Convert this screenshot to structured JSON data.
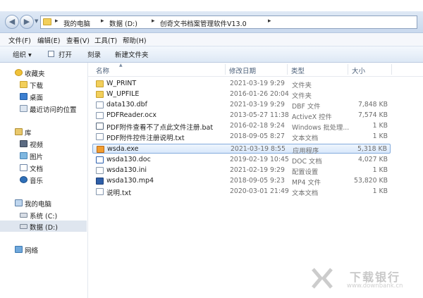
{
  "address": {
    "breadcrumbs": [
      "我的电脑",
      "数据 (D:)",
      "创奇文书档案管理软件V13.0"
    ]
  },
  "menu": [
    "文件(F)",
    "编辑(E)",
    "查看(V)",
    "工具(T)",
    "帮助(H)"
  ],
  "toolbar": {
    "organize": "组织",
    "open": "打开",
    "burn": "刻录",
    "new_folder": "新建文件夹"
  },
  "nav": {
    "favorites": "收藏夹",
    "downloads": "下载",
    "desktop": "桌面",
    "recent": "最近访问的位置",
    "libraries": "库",
    "videos": "视频",
    "pictures": "图片",
    "documents": "文档",
    "music": "音乐",
    "computer": "我的电脑",
    "drive_c": "系统 (C:)",
    "drive_d": "数据 (D:)",
    "network": "网络"
  },
  "columns": {
    "name": "名称",
    "date": "修改日期",
    "type": "类型",
    "size": "大小"
  },
  "files": [
    {
      "name": "W_PRINT",
      "date": "2021-03-19 9:29",
      "type": "文件夹",
      "size": "",
      "icon": "folder-icon"
    },
    {
      "name": "W_UPFILE",
      "date": "2016-01-26 20:04",
      "type": "文件夹",
      "size": "",
      "icon": "folder-icon"
    },
    {
      "name": "data130.dbf",
      "date": "2021-03-19 9:29",
      "type": "DBF 文件",
      "size": "7,848 KB",
      "icon": "file-icon"
    },
    {
      "name": "PDFReader.ocx",
      "date": "2013-05-27 11:38",
      "type": "ActiveX 控件",
      "size": "7,574 KB",
      "icon": "activex-icon"
    },
    {
      "name": "PDF附件查看不了点此文件注册.bat",
      "date": "2016-02-18 9:24",
      "type": "Windows 批处理...",
      "size": "1 KB",
      "icon": "batch-icon"
    },
    {
      "name": "PDF附件控件注册说明.txt",
      "date": "2018-09-05 8:27",
      "type": "文本文档",
      "size": "1 KB",
      "icon": "text-file-icon"
    },
    {
      "name": "wsda.exe",
      "date": "2021-03-19 8:55",
      "type": "应用程序",
      "size": "5,318 KB",
      "icon": "exe-icon"
    },
    {
      "name": "wsda130.doc",
      "date": "2019-02-19 10:45",
      "type": "DOC 文档",
      "size": "4,027 KB",
      "icon": "doc-icon"
    },
    {
      "name": "wsda130.ini",
      "date": "2021-02-19 9:29",
      "type": "配置设置",
      "size": "1 KB",
      "icon": "ini-icon"
    },
    {
      "name": "wsda130.mp4",
      "date": "2018-09-05 9:23",
      "type": "MP4 文件",
      "size": "53,820 KB",
      "icon": "video-file-icon"
    },
    {
      "name": "说明.txt",
      "date": "2020-03-01 21:49",
      "type": "文本文档",
      "size": "1 KB",
      "icon": "text-file-icon"
    }
  ],
  "selected_file": "wsda.exe",
  "watermark": {
    "title": "下载银行",
    "url": "www.downbank.cn"
  },
  "colors": {
    "selection_border": "#84acdd",
    "folder": "#f2cf5b",
    "header_text": "#4c607a"
  }
}
